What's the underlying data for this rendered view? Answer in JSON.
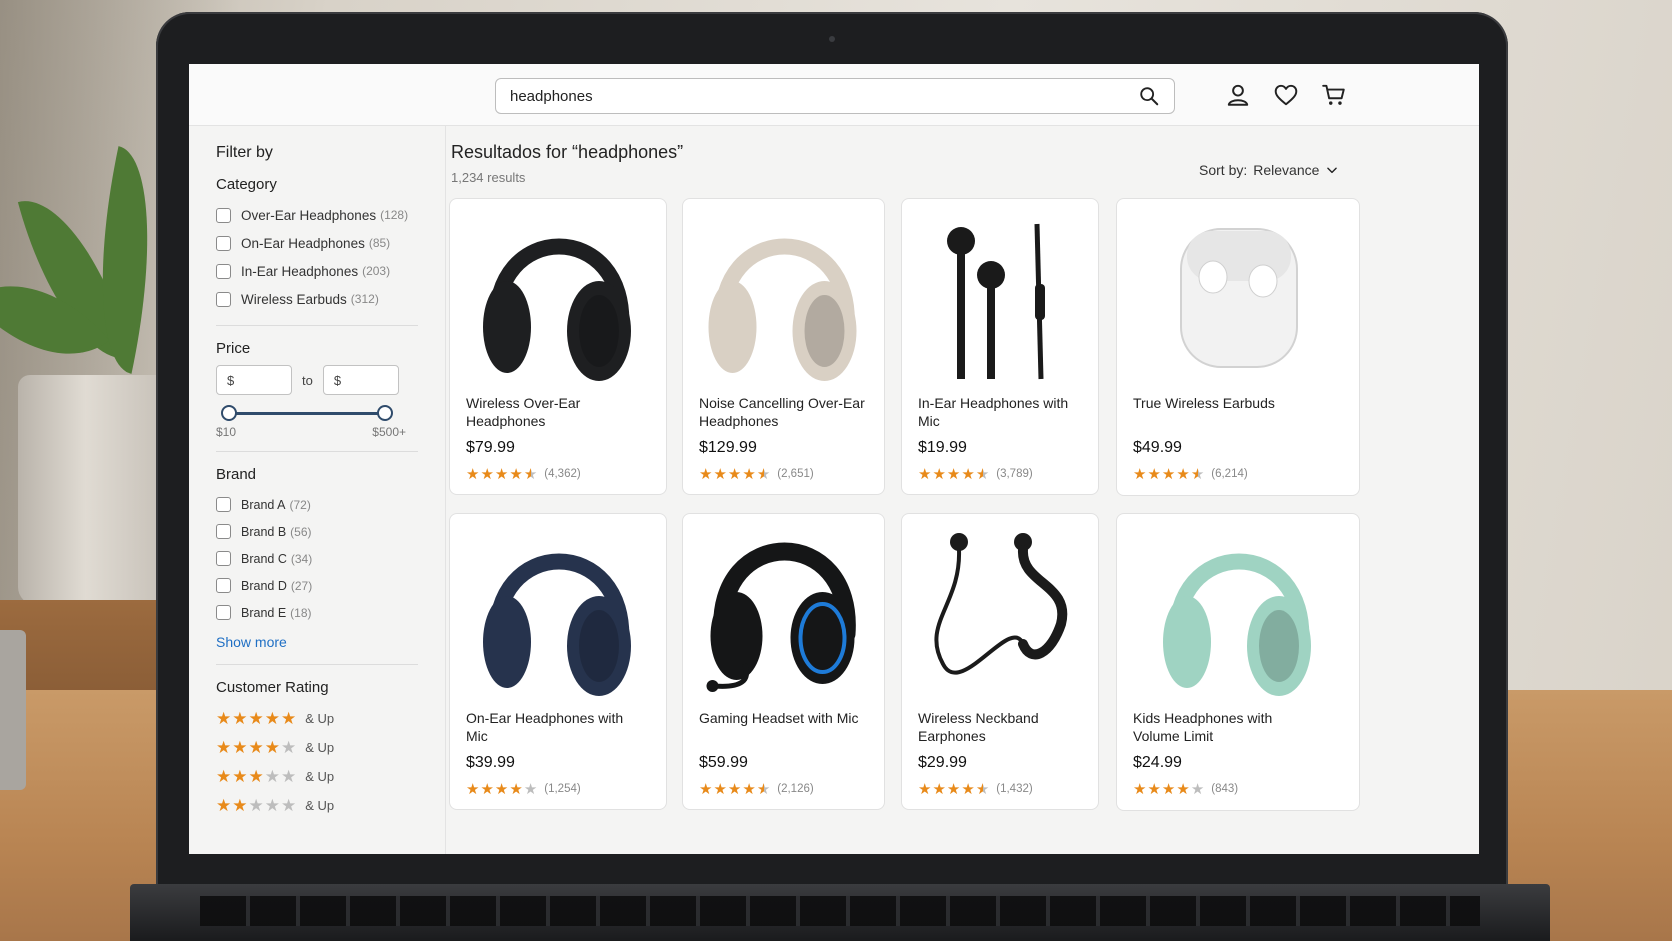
{
  "search": {
    "value": "headphones"
  },
  "header_icons": [
    "account-icon",
    "wishlist-heart-icon",
    "cart-icon"
  ],
  "sidebar": {
    "title": "Filter by",
    "category": {
      "heading": "Category",
      "items": [
        {
          "label": "Over-Ear Headphones",
          "count": "(128)"
        },
        {
          "label": "On-Ear Headphones",
          "count": "(85)"
        },
        {
          "label": "In-Ear Headphones",
          "count": "(203)"
        },
        {
          "label": "Wireless Earbuds",
          "count": "(312)"
        }
      ]
    },
    "price": {
      "heading": "Price",
      "min_placeholder": "$",
      "to_label": "to",
      "max_placeholder": "$",
      "slider_min_label": "$10",
      "slider_max_label": "$500+",
      "range_fraction": [
        0,
        1
      ]
    },
    "brand": {
      "heading": "Brand",
      "items": [
        {
          "label": "Brand A",
          "count": "(72)"
        },
        {
          "label": "Brand B",
          "count": "(56)"
        },
        {
          "label": "Brand C",
          "count": "(34)"
        },
        {
          "label": "Brand D",
          "count": "(27)"
        },
        {
          "label": "Brand E",
          "count": "(18)"
        }
      ],
      "show_more": "Show more"
    },
    "rating": {
      "heading": "Customer Rating",
      "suffix": "& Up",
      "levels": [
        5,
        4,
        3,
        2
      ]
    }
  },
  "results": {
    "title": "Resultados for “headphones”",
    "count": "1,234 results",
    "sort_label": "Sort by:",
    "sort_value": "Relevance"
  },
  "products": [
    {
      "name": "Wireless Over-Ear Headphones",
      "price": "$79.99",
      "rating": 4.5,
      "reviews": "(4,362)",
      "image": "over-ear-headphones-black",
      "color": "#1e1f21"
    },
    {
      "name": "Noise Cancelling Over-Ear Headphones",
      "price": "$129.99",
      "rating": 4.5,
      "reviews": "(2,651)",
      "image": "over-ear-headphones-beige",
      "color": "#d9d0c4"
    },
    {
      "name": "In-Ear Headphones with Mic",
      "price": "$19.99",
      "rating": 4.5,
      "reviews": "(3,789)",
      "image": "in-ear-earphones-black",
      "color": "#1a1a1a"
    },
    {
      "name": "True Wireless Earbuds",
      "price": "$49.99",
      "rating": 4.5,
      "reviews": "(6,214)",
      "image": "wireless-earbuds-case-white",
      "color": "#f2f2f2"
    },
    {
      "name": "On-Ear Headphones with Mic",
      "price": "$39.99",
      "rating": 4,
      "reviews": "(1,254)",
      "image": "on-ear-headphones-navy",
      "color": "#26334d"
    },
    {
      "name": "Gaming Headset with Mic",
      "price": "$59.99",
      "rating": 4.5,
      "reviews": "(2,126)",
      "image": "gaming-headset-black-blue",
      "color": "#151617"
    },
    {
      "name": "Wireless Neckband Earphones",
      "price": "$29.99",
      "rating": 4.5,
      "reviews": "(1,432)",
      "image": "neckband-earphones-black",
      "color": "#1b1b1b"
    },
    {
      "name": "Kids Headphones with Volume Limit",
      "price": "$24.99",
      "rating": 4,
      "reviews": "(843)",
      "image": "kids-headphones-mint",
      "color": "#9fd3c2"
    }
  ],
  "colors": {
    "star": "#e88a1a",
    "star_off": "#bdbdbd",
    "link": "#1f6fc4",
    "slider": "#2f4b6b"
  }
}
